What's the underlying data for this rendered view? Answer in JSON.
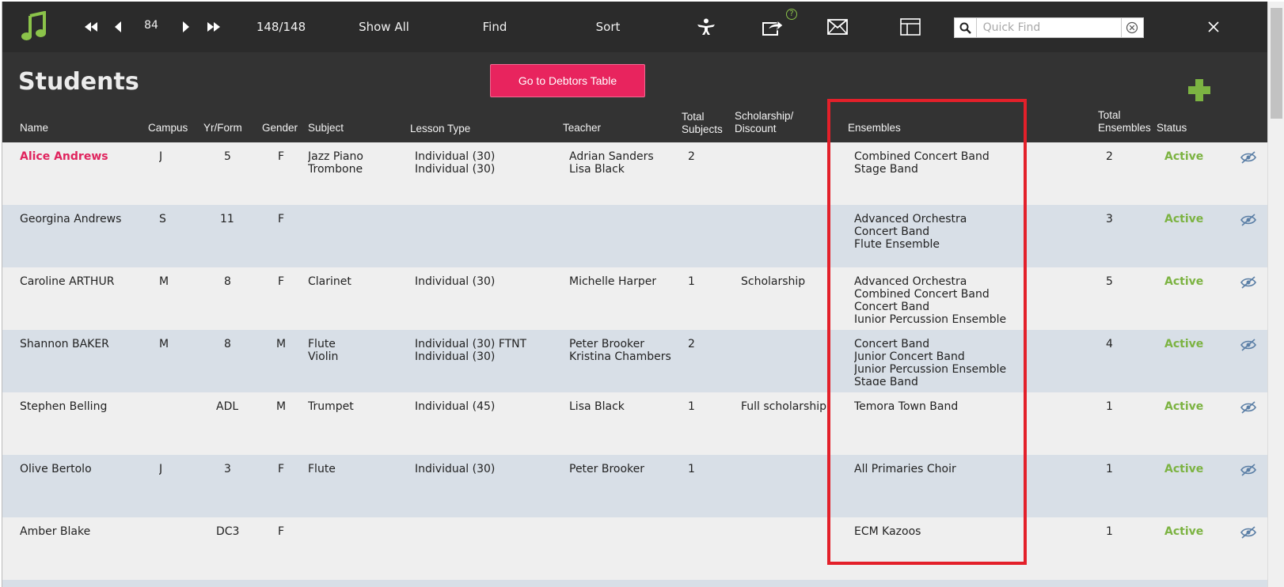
{
  "toolbar": {
    "record_number": "84",
    "record_count": "148/148",
    "show_all": "Show All",
    "find": "Find",
    "sort": "Sort",
    "help_badge": "?"
  },
  "quick_find": {
    "placeholder": "Quick Find"
  },
  "page": {
    "title": "Students",
    "debtors_button": "Go to Debtors Table"
  },
  "columns": {
    "name": "Name",
    "campus": "Campus",
    "yr_form": "Yr/Form",
    "gender": "Gender",
    "subject": "Subject",
    "lesson_type": "Lesson Type",
    "teacher": "Teacher",
    "total_subjects": "Total\nSubjects",
    "scholarship": "Scholarship/\nDiscount",
    "ensembles": "Ensembles",
    "total_ensembles": "Total\nEnsembles",
    "status": "Status"
  },
  "rows": [
    {
      "name": "Alice Andrews",
      "campus": "J",
      "yr_form": "5",
      "gender": "F",
      "subject": "Jazz Piano\nTrombone",
      "lesson_type": "Individual (30)\nIndividual (30)",
      "teacher": "Adrian Sanders\nLisa Black",
      "total_subjects": "2",
      "scholarship": "",
      "ensembles": "Combined Concert Band\nStage Band",
      "total_ensembles": "2",
      "status": "Active"
    },
    {
      "name": "Georgina Andrews",
      "campus": "S",
      "yr_form": "11",
      "gender": "F",
      "subject": "",
      "lesson_type": "",
      "teacher": "",
      "total_subjects": "",
      "scholarship": "",
      "ensembles": "Advanced Orchestra\nConcert Band\nFlute Ensemble",
      "total_ensembles": "3",
      "status": "Active"
    },
    {
      "name": "Caroline ARTHUR",
      "campus": "M",
      "yr_form": "8",
      "gender": "F",
      "subject": "Clarinet",
      "lesson_type": "Individual (30)",
      "teacher": "Michelle Harper",
      "total_subjects": "1",
      "scholarship": "Scholarship",
      "ensembles": "Advanced Orchestra\nCombined Concert Band\nConcert Band\nJunior Percussion Ensemble",
      "total_ensembles": "5",
      "status": "Active"
    },
    {
      "name": "Shannon BAKER",
      "campus": "M",
      "yr_form": "8",
      "gender": "M",
      "subject": "Flute\nViolin",
      "lesson_type": "Individual (30) FTNT\nIndividual (30)",
      "teacher": "Peter Brooker\nKristina Chambers",
      "total_subjects": "2",
      "scholarship": "",
      "ensembles": "Concert Band\nJunior Concert Band\nJunior Percussion Ensemble\nStage Band",
      "total_ensembles": "4",
      "status": "Active"
    },
    {
      "name": "Stephen Belling",
      "campus": "",
      "yr_form": "ADL",
      "gender": "M",
      "subject": "Trumpet",
      "lesson_type": "Individual (45)",
      "teacher": "Lisa Black",
      "total_subjects": "1",
      "scholarship": "Full scholarship",
      "ensembles": "Temora Town Band",
      "total_ensembles": "1",
      "status": "Active"
    },
    {
      "name": "Olive Bertolo",
      "campus": "J",
      "yr_form": "3",
      "gender": "F",
      "subject": "Flute",
      "lesson_type": "Individual (30)",
      "teacher": "Peter Brooker",
      "total_subjects": "1",
      "scholarship": "",
      "ensembles": "All Primaries Choir",
      "total_ensembles": "1",
      "status": "Active"
    },
    {
      "name": "Amber Blake",
      "campus": "",
      "yr_form": "DC3",
      "gender": "F",
      "subject": "",
      "lesson_type": "",
      "teacher": "",
      "total_subjects": "",
      "scholarship": "",
      "ensembles": "ECM Kazoos",
      "total_ensembles": "1",
      "status": "Active"
    }
  ],
  "colors": {
    "toolbar_bg": "#2b2b2b",
    "header_bg": "#333333",
    "accent_pink": "#e8245e",
    "status_green": "#7cb342",
    "highlight_red": "#e3202a",
    "row_alt": "#d8dfe7"
  },
  "icons": [
    "music-note-icon",
    "first-record-icon",
    "prev-record-icon",
    "next-record-icon",
    "last-record-icon",
    "reach-icon",
    "share-icon",
    "mail-icon",
    "layout-icon",
    "search-icon",
    "clear-icon",
    "close-icon",
    "plus-icon",
    "visibility-icon"
  ]
}
